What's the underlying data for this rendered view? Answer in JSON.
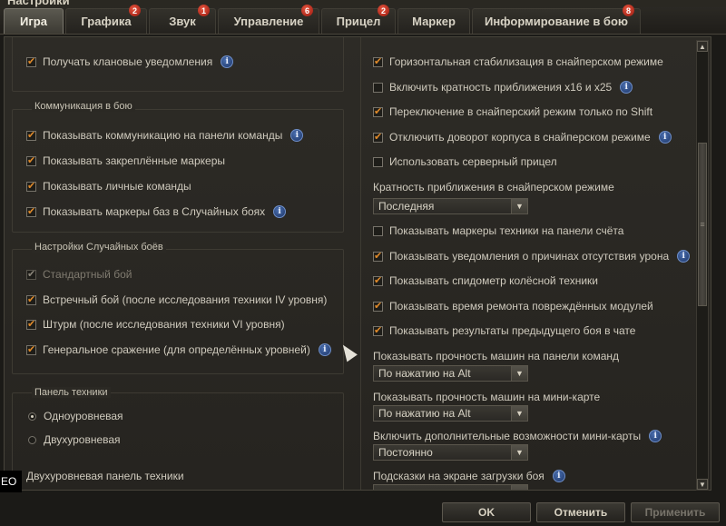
{
  "window": {
    "title": "Настройки"
  },
  "tabs": [
    {
      "label": "Игра",
      "badge": ""
    },
    {
      "label": "Графика",
      "badge": "2"
    },
    {
      "label": "Звук",
      "badge": "1"
    },
    {
      "label": "Управление",
      "badge": "6"
    },
    {
      "label": "Прицел",
      "badge": "2"
    },
    {
      "label": "Маркер",
      "badge": ""
    },
    {
      "label": "Информирование в бою",
      "badge": "8"
    }
  ],
  "left": {
    "clan_notifications": {
      "label": "Получать клановые уведомления",
      "checked": true
    },
    "communication": {
      "title": "Коммуникация в бою",
      "items": [
        {
          "label": "Показывать коммуникацию на панели команды",
          "checked": true
        },
        {
          "label": "Показывать закреплённые маркеры",
          "checked": true
        },
        {
          "label": "Показывать личные команды",
          "checked": true
        },
        {
          "label": "Показывать маркеры баз в Случайных боях",
          "checked": true
        }
      ]
    },
    "random_battles": {
      "title": "Настройки Случайных боёв",
      "items": [
        {
          "label": "Стандартный бой",
          "checked": true
        },
        {
          "label": "Встречный бой (после исследования техники IV уровня)",
          "checked": true
        },
        {
          "label": "Штурм (после исследования техники VI уровня)",
          "checked": true
        },
        {
          "label": "Генеральное сражение (для определённых уровней)",
          "checked": true
        }
      ]
    },
    "vehicle_panel": {
      "title": "Панель техники",
      "options": [
        {
          "label": "Одноуровневая",
          "selected": true
        },
        {
          "label": "Двухуровневая",
          "selected": false
        }
      ]
    },
    "two_level_label": "Двухуровневая панель техники"
  },
  "right": {
    "checks_top": [
      {
        "label": "Горизонтальная стабилизация в снайперском режиме",
        "checked": true
      },
      {
        "label": "Включить кратность приближения x16 и x25",
        "checked": false
      },
      {
        "label": "Переключение в снайперский режим только по Shift",
        "checked": true
      },
      {
        "label": "Отключить доворот корпуса в снайперском режиме",
        "checked": true
      },
      {
        "label": "Использовать серверный прицел",
        "checked": false
      }
    ],
    "zoom_label": "Кратность приближения в снайперском режиме",
    "zoom_value": "Последняя",
    "checks_mid": [
      {
        "label": "Показывать маркеры техники на панели счёта",
        "checked": false
      },
      {
        "label": "Показывать уведомления о причинах отсутствия урона",
        "checked": true
      },
      {
        "label": "Показывать спидометр колёсной техники",
        "checked": true
      },
      {
        "label": "Показывать время ремонта повреждённых модулей",
        "checked": true
      },
      {
        "label": "Показывать результаты предыдущего боя в чате",
        "checked": true
      }
    ],
    "hp_team_label": "Показывать прочность машин на панели команд",
    "hp_team_value": "По нажатию на Alt",
    "hp_minimap_label": "Показывать прочность машин на мини-карте",
    "hp_minimap_value": "По нажатию на Alt",
    "minimap_extra_label": "Включить дополнительные возможности мини-карты",
    "minimap_extra_value": "Постоянно",
    "loading_hints_label": "Подсказки на экране загрузки боя"
  },
  "info_glyph": "i",
  "buttons": {
    "ok": "OK",
    "cancel": "Отменить",
    "apply": "Применить"
  },
  "overlay_text": "EO",
  "colors": {
    "accent_check": "#e08a2a",
    "badge": "#c0281a",
    "info": "#2f4f8e"
  }
}
